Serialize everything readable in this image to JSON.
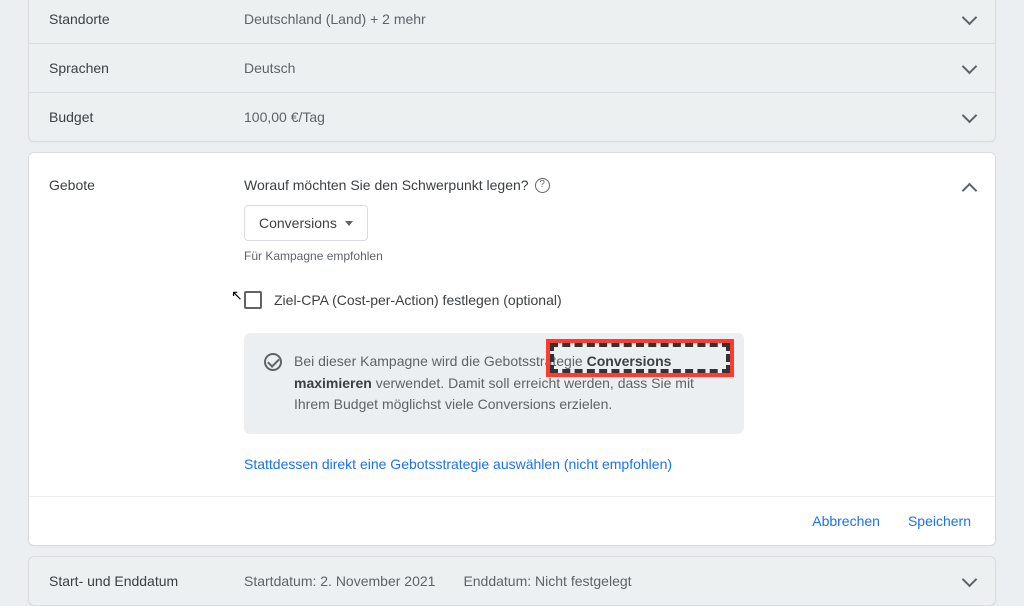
{
  "rows": {
    "standorte": {
      "label": "Standorte",
      "value": "Deutschland (Land) + 2 mehr"
    },
    "sprachen": {
      "label": "Sprachen",
      "value": "Deutsch"
    },
    "budget": {
      "label": "Budget",
      "value": "100,00 €/Tag"
    }
  },
  "gebote": {
    "label": "Gebote",
    "question": "Worauf möchten Sie den Schwerpunkt legen?",
    "dropdown": "Conversions",
    "hint": "Für Kampagne empfohlen",
    "checkboxLabel": "Ziel-CPA (Cost-per-Action) festlegen (optional)",
    "info_pre": "Bei dieser Kampagne wird die Gebotsstrategie ",
    "info_bold": "Conversions maximieren",
    "info_post": " verwendet. Damit soll erreicht werden, dass Sie mit Ihrem Budget möglichst viele Conversions erzielen.",
    "altLink": "Stattdessen direkt eine Gebotsstrategie auswählen (nicht empfohlen)"
  },
  "actions": {
    "cancel": "Abbrechen",
    "save": "Speichern"
  },
  "dates": {
    "label": "Start- und Enddatum",
    "start": "Startdatum: 2. November 2021",
    "end": "Enddatum: Nicht festgelegt"
  }
}
